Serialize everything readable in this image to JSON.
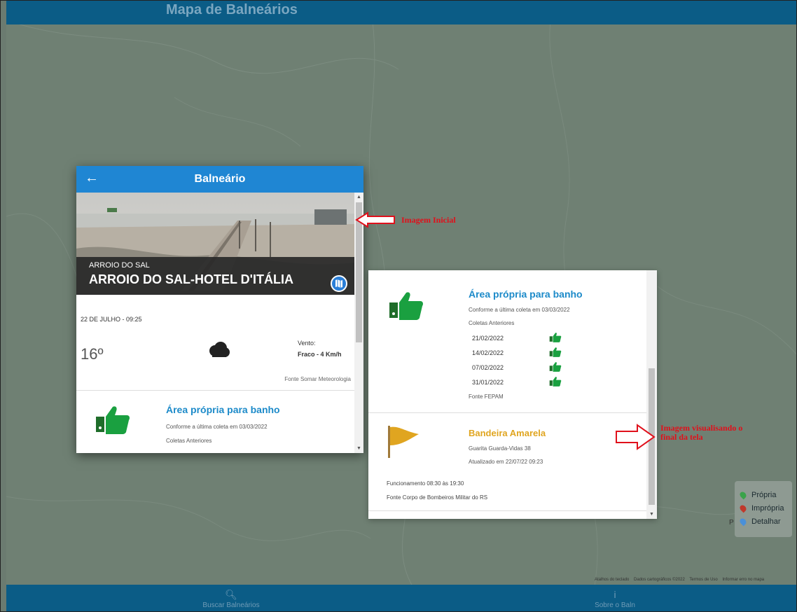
{
  "app": {
    "title": "Mapa de Balneários",
    "nav": [
      {
        "label": "Buscar Balneários",
        "icon": "search-icon"
      },
      {
        "label": "Sobre o Baln",
        "icon": "info-icon"
      }
    ]
  },
  "map": {
    "attribution": [
      "Atalhos do teclado",
      "Dados cartográficos ©2022",
      "Termos de Uso",
      "Informar erro no mapa"
    ],
    "legend": [
      {
        "label": "Própria",
        "color": "#3aa34a"
      },
      {
        "label": "Imprópria",
        "color": "#c0392b"
      },
      {
        "label": "Detalhar",
        "color": "#4a90d9"
      }
    ],
    "legend_behind_text": "P"
  },
  "annotations": {
    "inicial": "Imagem Inicial",
    "final": "Imagem visualisando o final da tela"
  },
  "panel1": {
    "header_title": "Balneário",
    "city": "ARROIO DO SAL",
    "beach_name": "ARROIO DO SAL-HOTEL D'ITÁLIA",
    "date": "22 DE JULHO - 09:25",
    "temperature": "16º",
    "wind_label": "Vento:",
    "wind_value": "Fraco - 4 Km/h",
    "weather_source": "Fonte Somar Meteorologia",
    "status_title": "Área própria para banho",
    "status_detail": "Conforme a última coleta em 03/03/2022",
    "previous_label": "Coletas Anteriores"
  },
  "panel2": {
    "status_title": "Área própria para banho",
    "status_detail": "Conforme a última coleta em 03/03/2022",
    "previous_label": "Coletas Anteriores",
    "previous": [
      "21/02/2022",
      "14/02/2022",
      "07/02/2022",
      "31/01/2022"
    ],
    "fepam_source": "Fonte FEPAM",
    "flag_title": "Bandeira Amarela",
    "guarita": "Guarita Guarda-Vidas 38",
    "updated": "Atualizado em 22/07/22 09:23",
    "hours": "Funcionamento 08:30 às 19:30",
    "flag_source": "Fonte Corpo de Bombeiros Militar do RS"
  },
  "colors": {
    "header_blue": "#1f86d3",
    "app_bar": "#0b5c86",
    "status_blue": "#1c8ac9",
    "thumb_green": "#1aa040",
    "flag_yellow": "#e0a520",
    "annotation_red": "#e0101b"
  }
}
